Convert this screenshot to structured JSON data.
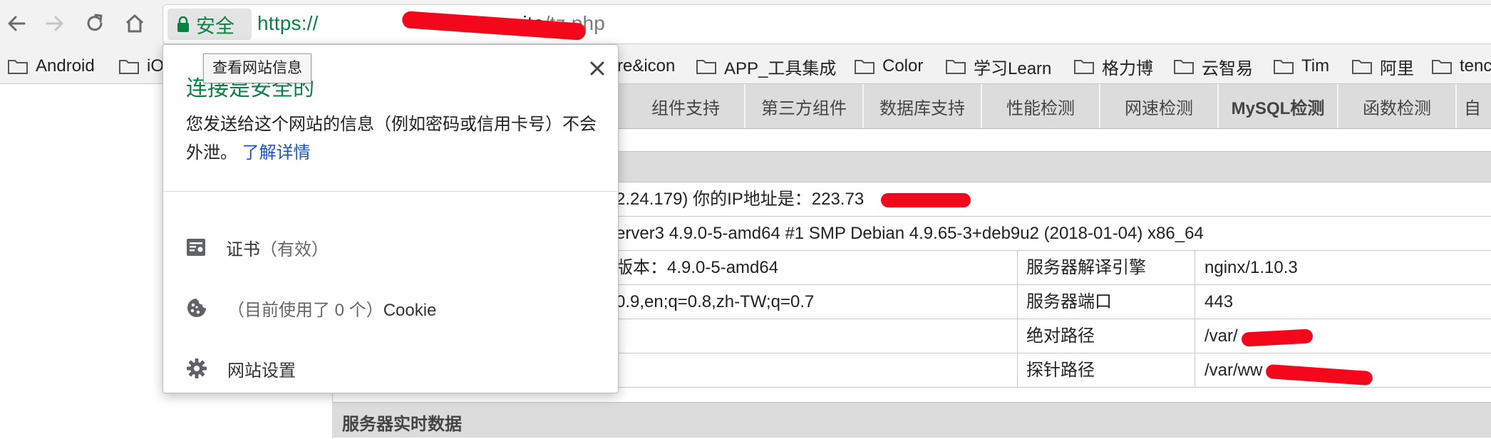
{
  "toolbar": {
    "security_label": "安全",
    "url": {
      "scheme": "https://",
      "host_end": "en.site",
      "path": "/tz.php"
    }
  },
  "bookmarks": [
    "Android",
    "iO",
    "re&icon",
    "APP_工具集成",
    "Color",
    "学习Learn",
    "格力博",
    "云智易",
    "Tim",
    "阿里",
    "tenc"
  ],
  "page": {
    "tabs": [
      "组件支持",
      "第三方组件",
      "数据库支持",
      "性能检测",
      "网速检测",
      "MySQL检测",
      "函数检测",
      "自"
    ],
    "rows": [
      {
        "left": "2.24.179)  你的IP地址是：223.73"
      },
      {
        "left": "erver3 4.9.0-5-amd64 #1 SMP Debian 4.9.65-3+deb9u2 (2018-01-04) x86_64"
      },
      {
        "left": "版本：4.9.0-5-amd64",
        "label": "服务器解译引擎",
        "value": "nginx/1.10.3"
      },
      {
        "left": "0.9,en;q=0.8,zh-TW;q=0.7",
        "label": "服务器端口",
        "value": "443"
      },
      {
        "left": "",
        "label": "绝对路径",
        "value": "/var/"
      },
      {
        "left": "",
        "label": "探针路径",
        "value": "/var/ww"
      }
    ],
    "realtime_title": "服务器实时数据"
  },
  "popup": {
    "tooltip": "查看网站信息",
    "title": "连接是安全的",
    "description": "您发送给这个网站的信息（例如密码或信用卡号）不会外泄。",
    "learn_more": "了解详情",
    "items": [
      {
        "text": "证书",
        "muted": "（有效）",
        "icon": "certificate-icon"
      },
      {
        "text_before": "（目前使用了 0 个）",
        "text": "Cookie",
        "icon": "cookie-icon"
      },
      {
        "text": "网站设置",
        "icon": "gear-icon"
      }
    ]
  },
  "colors": {
    "secure_green": "#0b8043",
    "link_blue": "#1a53c9",
    "redaction_red": "#f3071b"
  }
}
